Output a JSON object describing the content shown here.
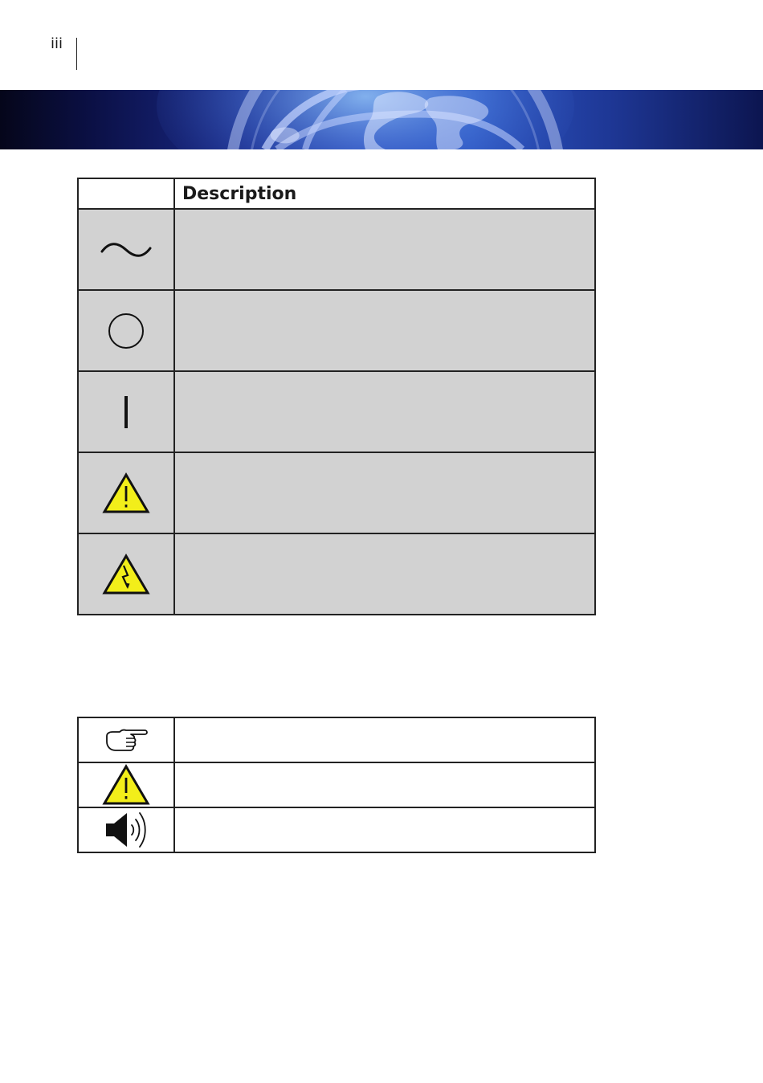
{
  "page": {
    "number": "iii"
  },
  "banner": {
    "icon": "globe-banner"
  },
  "symbols_table": {
    "header": {
      "symbol": "",
      "description": "Description"
    },
    "rows": [
      {
        "icon": "alternating-current-icon",
        "description": ""
      },
      {
        "icon": "power-off-icon",
        "description": ""
      },
      {
        "icon": "power-on-icon",
        "description": ""
      },
      {
        "icon": "caution-warning-icon",
        "description": ""
      },
      {
        "icon": "electric-shock-warning-icon",
        "description": ""
      }
    ]
  },
  "notes_table": {
    "rows": [
      {
        "icon": "pointing-hand-note-icon",
        "description": ""
      },
      {
        "icon": "caution-warning-icon",
        "description": ""
      },
      {
        "icon": "speaker-sound-icon",
        "description": ""
      }
    ]
  },
  "colors": {
    "cell_gray": "#d2d2d2",
    "warning_yellow": "#f2ee1a",
    "banner_blue": "#2a47b8"
  }
}
